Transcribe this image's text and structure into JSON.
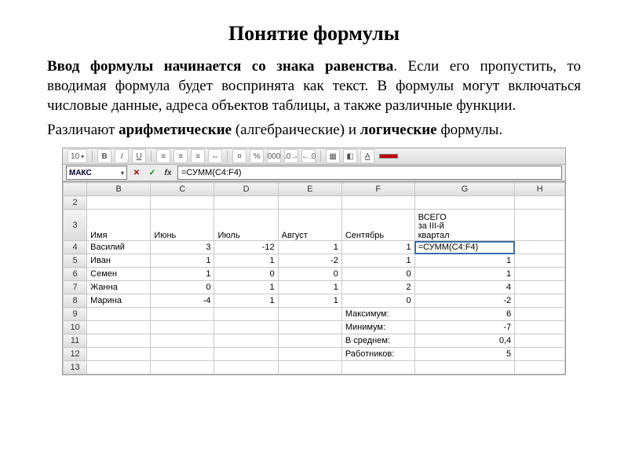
{
  "title": "Понятие формулы",
  "para1_lead_bold": "Ввод формулы начинается со знака равенства",
  "para1_rest": ". Если его пропустить, то вводимая формула будет воспринята как текст. В формулы могут включаться числовые данные, адреса объектов таблицы, а также различные функции.",
  "para2_a": "Различают ",
  "para2_b_bold": "арифметические",
  "para2_c": " (алгебраические) и ",
  "para2_d_bold": "логические",
  "para2_e": " формулы.",
  "sheet": {
    "namebox": "МАКС",
    "formula": "=СУММ(C4:F4)",
    "toolbar_font_size": "10",
    "columns": [
      "",
      "B",
      "C",
      "D",
      "E",
      "F",
      "G",
      "H"
    ],
    "row3": {
      "B": "Имя",
      "C": "Июнь",
      "D": "Июль",
      "E": "Август",
      "F": "Сентябрь",
      "G_line1": "ВСЕГО",
      "G_line2": "за III-й",
      "G_line3": "квартал"
    },
    "rows": [
      {
        "n": 4,
        "B": "Василий",
        "C": "3",
        "D": "-12",
        "E": "1",
        "F": "1",
        "G": "=СУММ(C4:F4)",
        "editing": true
      },
      {
        "n": 5,
        "B": "Иван",
        "C": "1",
        "D": "1",
        "E": "-2",
        "F": "1",
        "G": "1"
      },
      {
        "n": 6,
        "B": "Семен",
        "C": "1",
        "D": "0",
        "E": "0",
        "F": "0",
        "G": "1"
      },
      {
        "n": 7,
        "B": "Жанна",
        "C": "0",
        "D": "1",
        "E": "1",
        "F": "2",
        "G": "4"
      },
      {
        "n": 8,
        "B": "Марина",
        "C": "-4",
        "D": "1",
        "E": "1",
        "F": "0",
        "G": "-2"
      }
    ],
    "footer": [
      {
        "n": 9,
        "F": "Максимум:",
        "G": "6"
      },
      {
        "n": 10,
        "F": "Минимум:",
        "G": "-7"
      },
      {
        "n": 11,
        "F": "В среднем:",
        "G": "0,4"
      },
      {
        "n": 12,
        "F": "Работников:",
        "G": "5"
      }
    ],
    "blank_rows": [
      2,
      13
    ]
  }
}
